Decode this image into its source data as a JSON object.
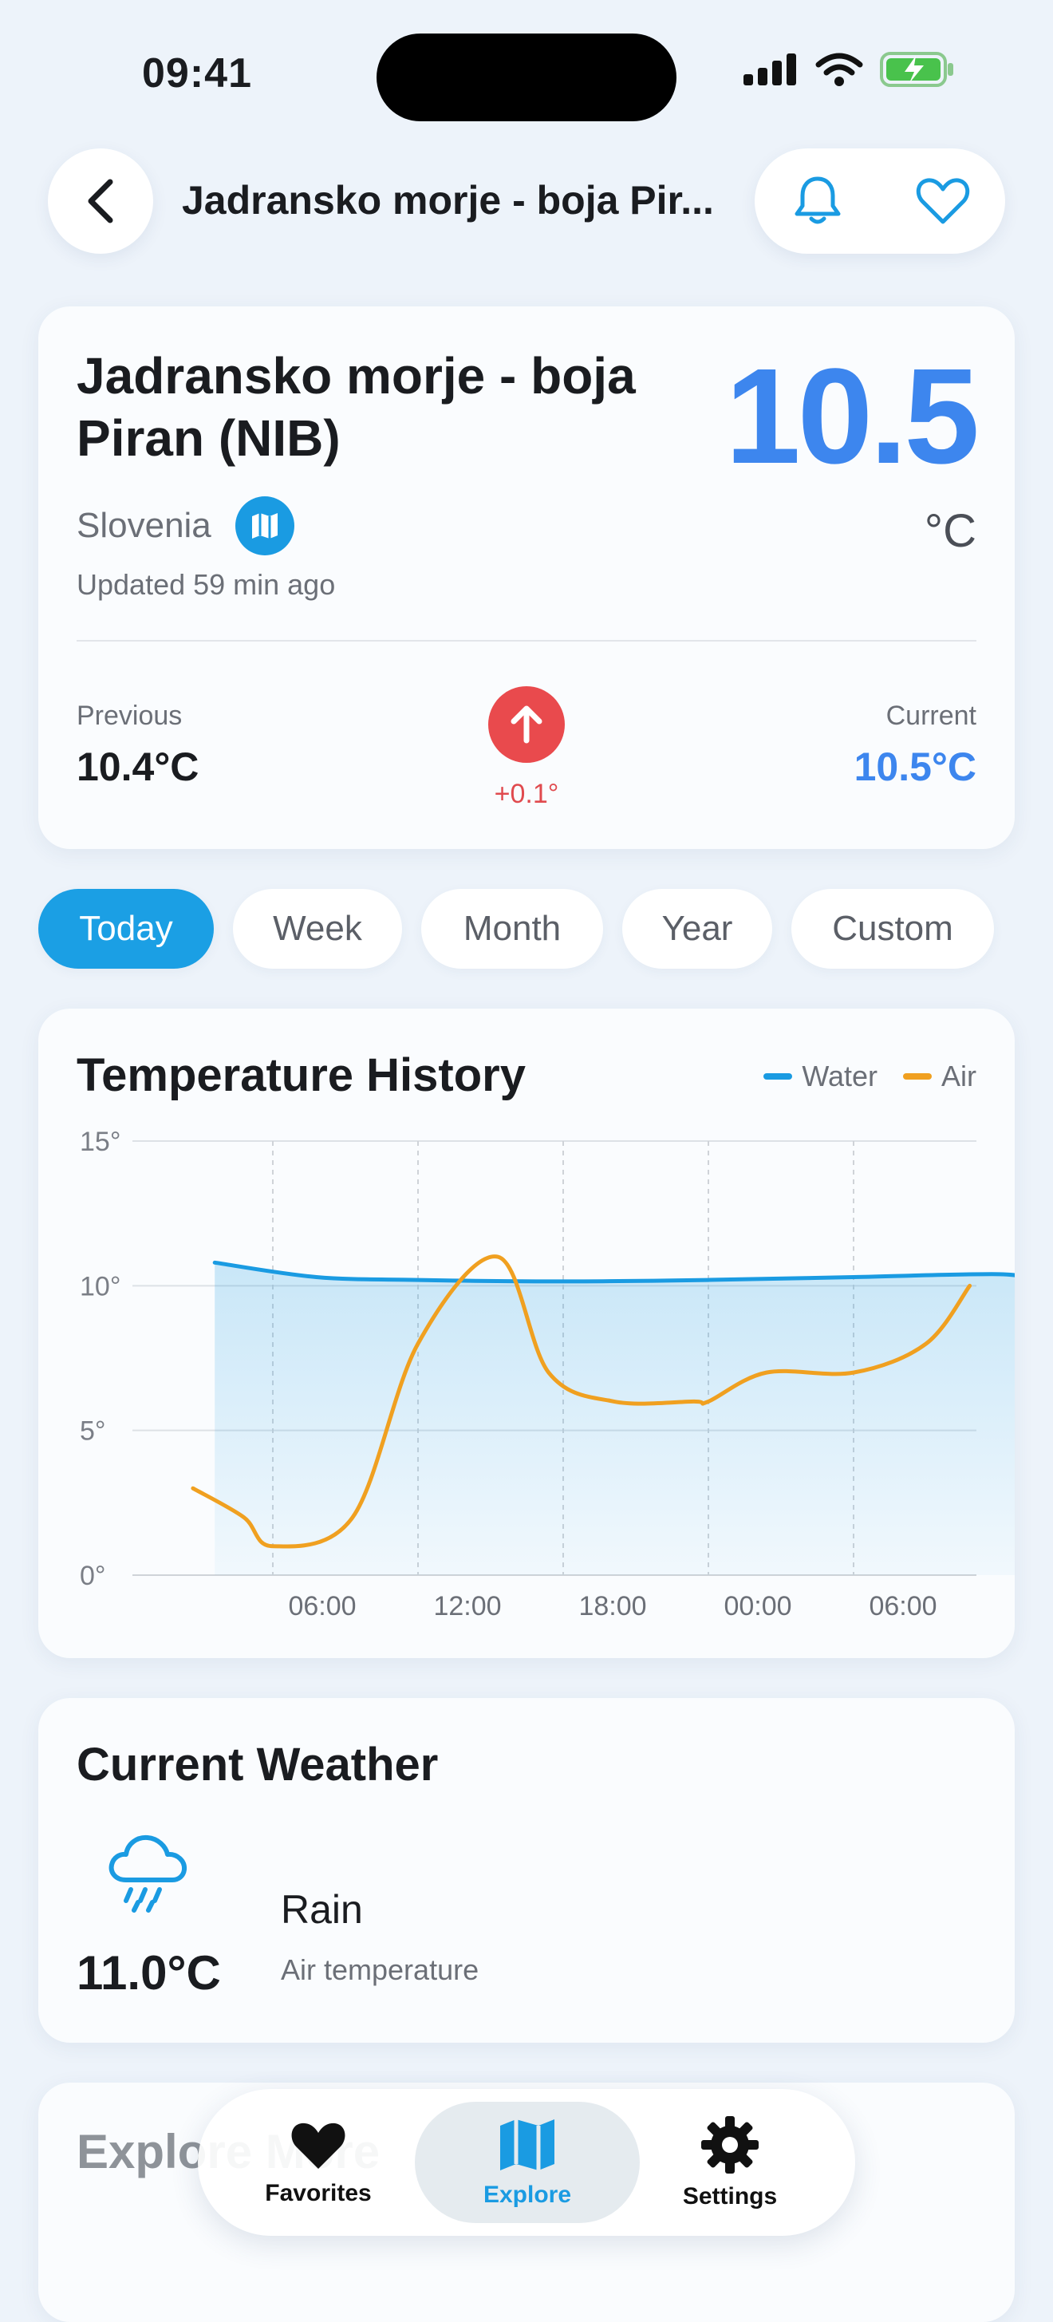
{
  "status_bar": {
    "time": "09:41"
  },
  "header": {
    "title": "Jadransko morje - boja Pir..."
  },
  "station": {
    "name": "Jadransko morje - boja Piran (NIB)",
    "country": "Slovenia",
    "updated": "Updated 59 min ago",
    "temperature": "10.5",
    "unit": "°C",
    "previous_label": "Previous",
    "previous_value": "10.4°C",
    "delta": "+0.1°",
    "current_label": "Current",
    "current_value": "10.5°C"
  },
  "periods": [
    {
      "label": "Today",
      "active": true
    },
    {
      "label": "Week",
      "active": false
    },
    {
      "label": "Month",
      "active": false
    },
    {
      "label": "Year",
      "active": false
    },
    {
      "label": "Custom",
      "active": false
    }
  ],
  "colors": {
    "accent": "#1b9fe4",
    "water": "#1a9be2",
    "air": "#f0a020",
    "alert": "#e94a4d",
    "temp_blue": "#3d86ee"
  },
  "chart_data": {
    "type": "line",
    "title": "Temperature History",
    "ylim": [
      0,
      15
    ],
    "y_ticks": [
      "0°",
      "5°",
      "10°",
      "15°"
    ],
    "x_ticks": [
      "06:00",
      "12:00",
      "18:00",
      "00:00",
      "06:00"
    ],
    "series": [
      {
        "name": "Water",
        "x": [
          -0.4,
          0.3,
          1.0,
          2.0,
          3.0,
          4.0,
          5.0,
          5.3,
          5.8
        ],
        "values": [
          10.8,
          10.3,
          10.2,
          10.15,
          10.2,
          10.3,
          10.4,
          10.2,
          10.5
        ]
      },
      {
        "name": "Air",
        "x": [
          -0.55,
          -0.2,
          0.0,
          0.55,
          1.0,
          1.55,
          1.9,
          2.35,
          2.9,
          3.0,
          3.4,
          4.0,
          4.5,
          4.8
        ],
        "values": [
          3.0,
          2.0,
          1.0,
          2.0,
          8.0,
          11.0,
          7.0,
          6.0,
          6.0,
          6.0,
          7.0,
          7.0,
          8.0,
          10.0
        ]
      }
    ],
    "legend": "top-right",
    "grid": true
  },
  "weather": {
    "title": "Current Weather",
    "temperature": "11.0°C",
    "condition": "Rain",
    "subtitle": "Air temperature"
  },
  "explore": {
    "title": "Explore More"
  },
  "nav": {
    "favorites": "Favorites",
    "explore": "Explore",
    "settings": "Settings"
  }
}
